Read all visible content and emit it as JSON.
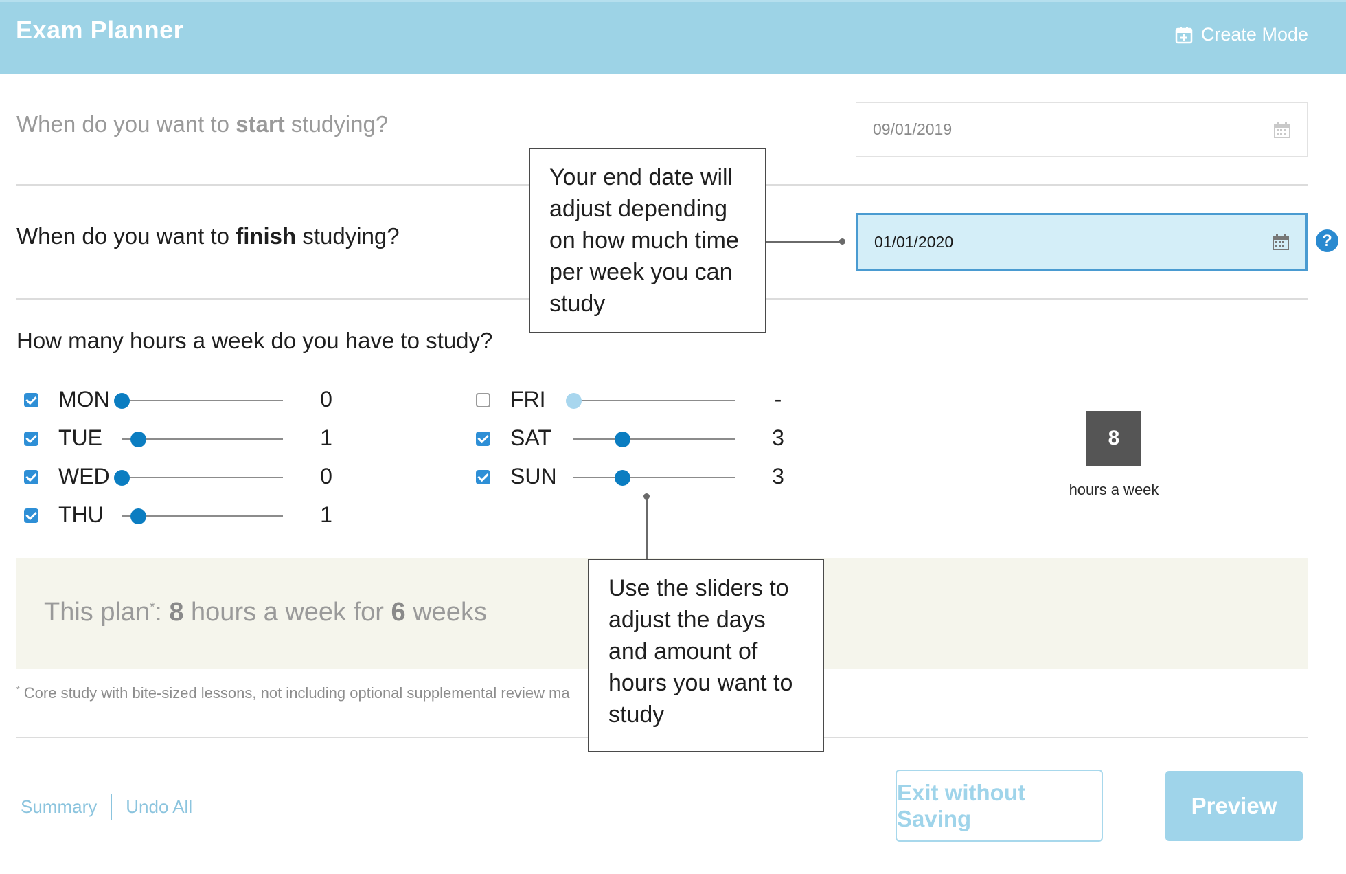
{
  "header": {
    "title": "Exam Planner",
    "mode_label": "Create Mode",
    "mode_icon": "calendar-plus-icon"
  },
  "questions": {
    "start_prefix": "When do you want to ",
    "start_bold": "start",
    "start_suffix": " studying?",
    "finish_prefix": "When do you want to ",
    "finish_bold": "finish",
    "finish_suffix": " studying?",
    "hours": "How many hours a week do you have to study?"
  },
  "dates": {
    "start_value": "09/01/2019",
    "finish_value": "01/01/2020",
    "calendar_icon": "calendar-icon",
    "help_icon_text": "?"
  },
  "days": [
    {
      "name": "MON",
      "checked": true,
      "hours": 0,
      "display": "0"
    },
    {
      "name": "TUE",
      "checked": true,
      "hours": 1,
      "display": "1"
    },
    {
      "name": "WED",
      "checked": true,
      "hours": 0,
      "display": "0"
    },
    {
      "name": "THU",
      "checked": true,
      "hours": 1,
      "display": "1"
    },
    {
      "name": "FRI",
      "checked": false,
      "hours": 0,
      "display": "-"
    },
    {
      "name": "SAT",
      "checked": true,
      "hours": 3,
      "display": "3"
    },
    {
      "name": "SUN",
      "checked": true,
      "hours": 3,
      "display": "3"
    }
  ],
  "total": {
    "value": "8",
    "label": "hours a week"
  },
  "plan": {
    "prefix": "This plan",
    "marker": "*",
    "colon": ": ",
    "hours": "8",
    "middle": " hours a week for ",
    "weeks": "6",
    "suffix": " weeks"
  },
  "footnote": {
    "marker": "*",
    "text": "Core study with bite-sized lessons, not including optional supplemental review ma"
  },
  "footer": {
    "summary": "Summary",
    "undo_all": "Undo All",
    "exit_button": "Exit without Saving",
    "preview_button": "Preview"
  },
  "callouts": {
    "end_date": "Your end date will adjust depending on how much time per week you can study",
    "sliders": "Use the sliders to adjust the days and amount of hours you want to study"
  },
  "colors": {
    "header_bg": "#9dd3e6",
    "accent": "#0b7dc1",
    "finish_field_bg": "#d4eef8",
    "button_light": "#9fd4ea"
  }
}
